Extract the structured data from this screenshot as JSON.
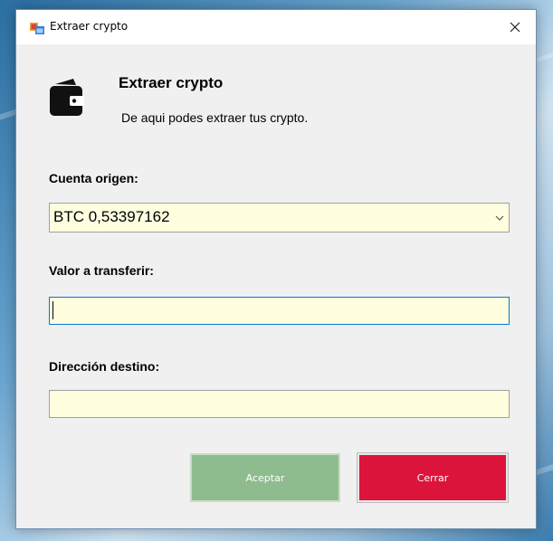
{
  "window": {
    "title": "Extraer crypto"
  },
  "header": {
    "title": "Extraer crypto",
    "subtitle": "De aqui podes extraer tus crypto."
  },
  "form": {
    "source_account_label": "Cuenta origen:",
    "source_account_value": "BTC 0,53397162",
    "amount_label": "Valor a transferir:",
    "amount_value": "",
    "destination_label": "Dirección destino:",
    "destination_value": ""
  },
  "buttons": {
    "accept_label": "Aceptar",
    "close_label": "Cerrar"
  },
  "icons": {
    "app": "app-window-icon",
    "header": "wallet-icon",
    "close": "close-icon",
    "dropdown": "chevron-down-icon"
  },
  "colors": {
    "input_background": "#ffffe0",
    "accept_button": "#8fbc8f",
    "close_button": "#dc143c",
    "focus_border": "#0078d7"
  }
}
